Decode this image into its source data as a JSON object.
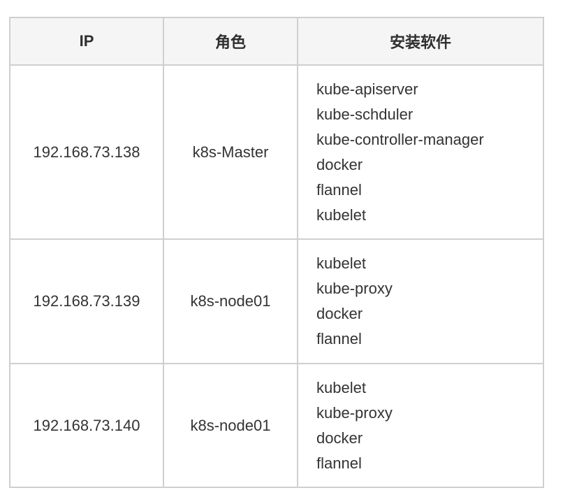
{
  "table": {
    "headers": [
      "IP",
      "角色",
      "安装软件"
    ],
    "rows": [
      {
        "ip": "192.168.73.138",
        "role": "k8s-Master",
        "software": [
          "kube-apiserver",
          "kube-schduler",
          "kube-controller-manager",
          "docker",
          "flannel",
          "kubelet"
        ]
      },
      {
        "ip": "192.168.73.139",
        "role": "k8s-node01",
        "software": [
          "kubelet",
          "kube-proxy",
          "docker",
          "flannel"
        ]
      },
      {
        "ip": "192.168.73.140",
        "role": "k8s-node01",
        "software": [
          "kubelet",
          "kube-proxy",
          "docker",
          "flannel"
        ]
      }
    ]
  }
}
